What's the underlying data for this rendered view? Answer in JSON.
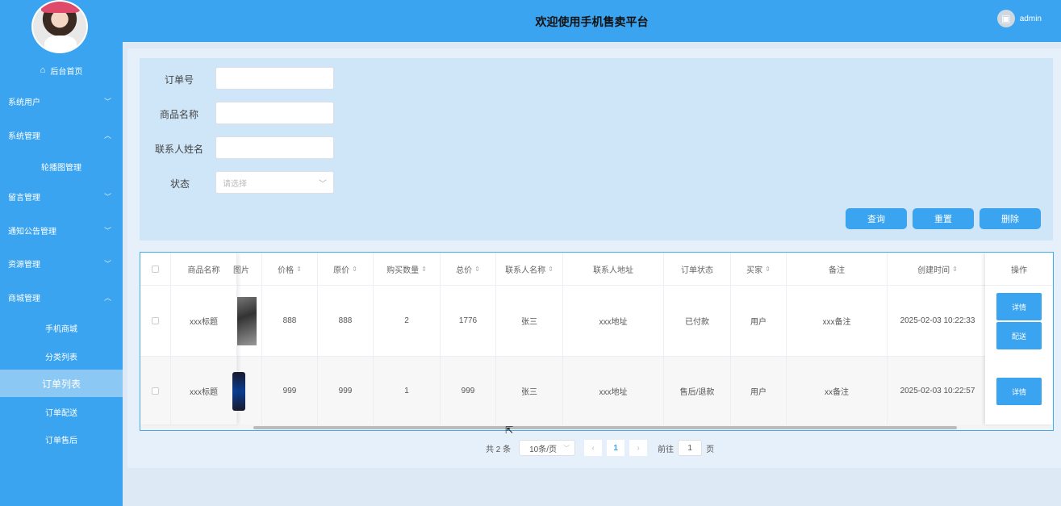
{
  "header": {
    "title": "欢迎使用手机售卖平台",
    "user": "admin"
  },
  "sidebar": {
    "home": "后台首页",
    "items": [
      {
        "label": "系统用户",
        "chevron": "﹀"
      },
      {
        "label": "系统管理",
        "chevron": "︿"
      },
      {
        "label": "轮播图管理"
      },
      {
        "label": "留言管理",
        "chevron": "﹀"
      },
      {
        "label": "通知公告管理",
        "chevron": "﹀"
      },
      {
        "label": "资源管理",
        "chevron": "﹀"
      },
      {
        "label": "商城管理",
        "chevron": "︿"
      },
      {
        "label": "手机商城"
      },
      {
        "label": "分类列表"
      },
      {
        "label": "订单列表"
      },
      {
        "label": "订单配送"
      },
      {
        "label": "订单售后"
      }
    ]
  },
  "search": {
    "order_no_label": "订单号",
    "product_name_label": "商品名称",
    "contact_name_label": "联系人姓名",
    "status_label": "状态",
    "status_placeholder": "请选择",
    "query_button": "查询",
    "reset_button": "重置",
    "delete_button": "删除"
  },
  "table": {
    "headers": {
      "name": "商品名称",
      "image": "图片",
      "price": "价格",
      "original_price": "原价",
      "quantity": "购买数量",
      "total": "总价",
      "contact_name": "联系人名称",
      "contact_address": "联系人地址",
      "order_status": "订单状态",
      "buyer": "买家",
      "remark": "备注",
      "created": "创建时间",
      "ops": "操作"
    },
    "rows": [
      {
        "name": "xxx标题",
        "price": "888",
        "original_price": "888",
        "quantity": "2",
        "total": "1776",
        "contact_name": "张三",
        "contact_address": "xxx地址",
        "order_status": "已付款",
        "buyer": "用户",
        "remark": "xxx备注",
        "created": "2025-02-03 10:22:33",
        "ops": [
          "详情",
          "配送"
        ]
      },
      {
        "name": "xxx标题",
        "price": "999",
        "original_price": "999",
        "quantity": "1",
        "total": "999",
        "contact_name": "张三",
        "contact_address": "xxx地址",
        "order_status": "售后/退款",
        "buyer": "用户",
        "remark": "xx备注",
        "created": "2025-02-03 10:22:57",
        "ops": [
          "详情"
        ]
      }
    ]
  },
  "pagination": {
    "total": "共 2 条",
    "page_size": "10条/页",
    "current_page": "1",
    "goto_label": "前往",
    "goto_value": "1",
    "page_suffix": "页"
  }
}
